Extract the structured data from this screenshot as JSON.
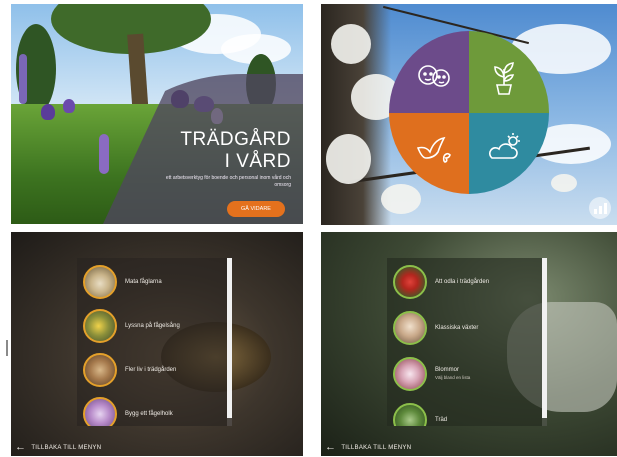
{
  "hero": {
    "title_line1": "TRÄDGÅRD",
    "title_line2": "I VÅRD",
    "subtitle": "ett arbetsverktyg för boende och personal inom vård och omsorg",
    "cta_label": "GÅ VIDARE",
    "accent": "#e4711d"
  },
  "menu_wheel": {
    "sections": [
      {
        "icon": "people-faces-icon",
        "color": "#6c4b8a"
      },
      {
        "icon": "potted-plant-icon",
        "color": "#6e9a3a"
      },
      {
        "icon": "bird-butterfly-icon",
        "color": "#df6f1e"
      },
      {
        "icon": "sun-cloud-icon",
        "color": "#2f8ba0"
      }
    ],
    "stats_icon": "bar-chart-icon"
  },
  "list_birds": {
    "items": [
      {
        "label": "Mata fåglarna",
        "thumb": "#c9b48a"
      },
      {
        "label": "Lyssna på fågelsång",
        "thumb": "#8b8f3a"
      },
      {
        "label": "Fler liv i trädgården",
        "thumb": "#a67a4d"
      },
      {
        "label": "Bygg ett fågelholk",
        "thumb": "#b78ac9"
      }
    ],
    "back_label": "TILLBAKA TILL MENYN"
  },
  "list_plants": {
    "items": [
      {
        "label": "Att odla i trädgården",
        "sub": "",
        "thumb": "#b3261e"
      },
      {
        "label": "Klassiska växter",
        "sub": "",
        "thumb": "#c9a98a"
      },
      {
        "label": "Blommor",
        "sub": "Välj bland en lista",
        "thumb": "#d9a7b8"
      },
      {
        "label": "Träd",
        "sub": "",
        "thumb": "#5e8a3c"
      }
    ],
    "back_label": "TILLBAKA TILL MENYN"
  }
}
